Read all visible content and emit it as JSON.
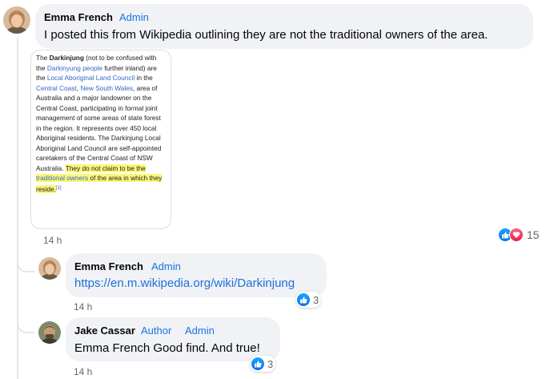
{
  "comments": [
    {
      "author": "Emma French",
      "badges": [
        "Admin"
      ],
      "text": "I posted this from Wikipedia outlining they are not the traditional owners of the area.",
      "time": "14 h",
      "reaction_count": "15",
      "reaction_icons": [
        "like-icon",
        "love-icon"
      ],
      "attached_image": {
        "segments": [
          {
            "t": "The ",
            "s": ""
          },
          {
            "t": "Darkinjung",
            "s": "b"
          },
          {
            "t": " (not to be confused with the ",
            "s": ""
          },
          {
            "t": "Darkinyung people",
            "s": "l"
          },
          {
            "t": " further inland) are the ",
            "s": ""
          },
          {
            "t": "Local Aboriginal Land Council",
            "s": "l"
          },
          {
            "t": " in the ",
            "s": ""
          },
          {
            "t": "Central Coast",
            "s": "l"
          },
          {
            "t": ", ",
            "s": ""
          },
          {
            "t": "New South Wales",
            "s": "l"
          },
          {
            "t": ", area of Australia and a major landowner on the Central Coast, participating in formal joint management of some areas of state forest in the region. It represents over 450 local Aboriginal residents. The Darkinjung Local Aboriginal Land Council are self-appointed caretakers of the Central Coast of NSW Australia. ",
            "s": ""
          },
          {
            "t": "They do not claim to be the ",
            "s": "h"
          },
          {
            "t": "traditional owners",
            "s": "hl"
          },
          {
            "t": " of the area in which they reside.",
            "s": "h"
          },
          {
            "t": "[1]",
            "s": "sup"
          }
        ]
      }
    },
    {
      "author": "Emma French",
      "badges": [
        "Admin"
      ],
      "link": "https://en.m.wikipedia.org/wiki/Darkinjung",
      "time": "14 h",
      "reaction_count": "3",
      "reaction_icons": [
        "like-icon"
      ]
    },
    {
      "author": "Jake Cassar",
      "badges": [
        "Author",
        "Admin"
      ],
      "text": "Emma French Good find. And true!",
      "time": "14 h",
      "reaction_count": "3",
      "reaction_icons": [
        "like-icon"
      ]
    }
  ],
  "colors": {
    "bubble": "#f0f2f5",
    "badge": "#1b74e4",
    "link": "#216fdb",
    "like": "#0a6df0",
    "love": "#e61e4d",
    "highlight": "#fdf779"
  }
}
